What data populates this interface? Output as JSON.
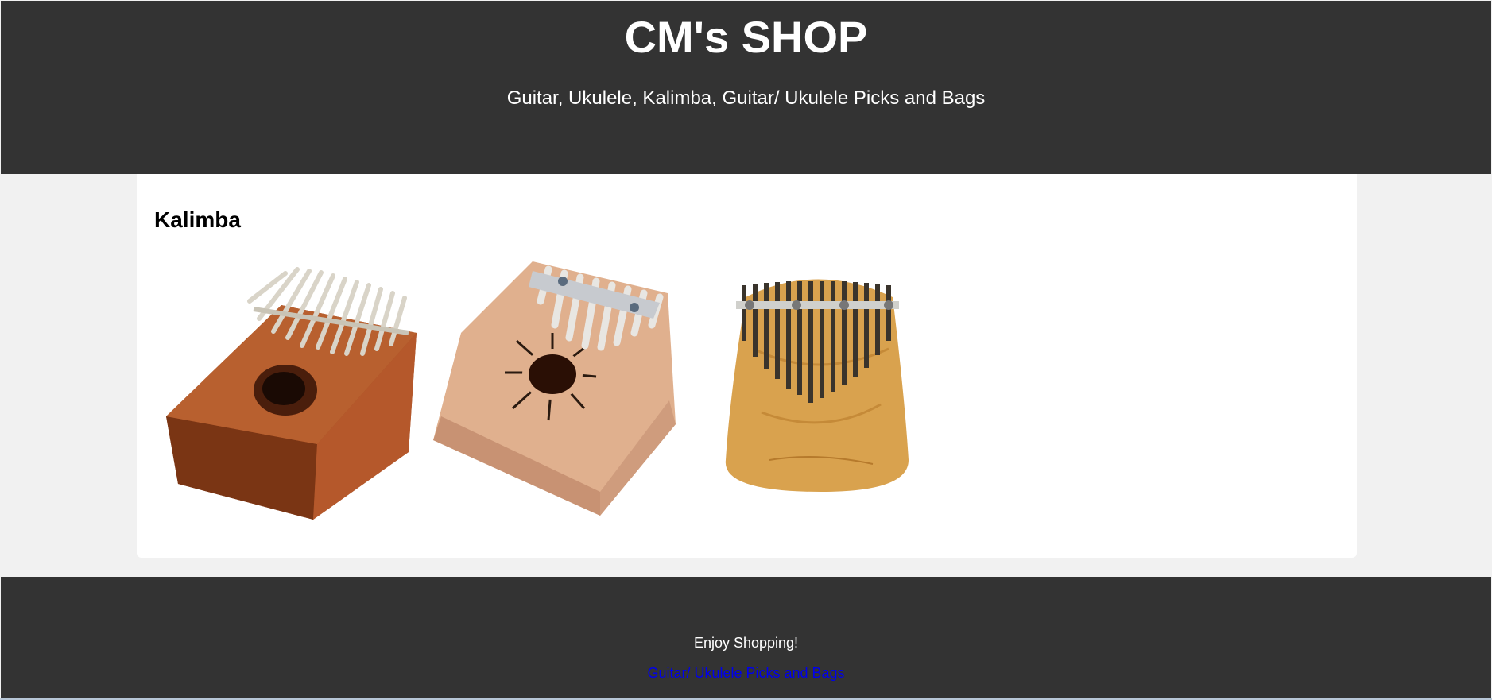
{
  "header": {
    "title": "CM's SHOP",
    "subtitle": "Guitar, Ukulele, Kalimba, Guitar/ Ukulele Picks and Bags"
  },
  "section": {
    "heading": "Kalimba",
    "products": [
      {
        "image": "kalimba-mahogany-image"
      },
      {
        "image": "kalimba-light-wood-image"
      },
      {
        "image": "kalimba-rounded-wood-image"
      }
    ]
  },
  "footer": {
    "message": "Enjoy Shopping!",
    "link_label": "Guitar/ Ukulele Picks and Bags"
  },
  "colors": {
    "header_bg": "#333333",
    "page_bg": "#f1f1f1",
    "link": "#0000ee"
  }
}
